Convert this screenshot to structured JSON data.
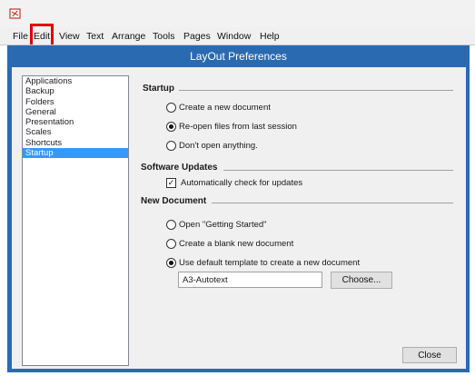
{
  "app": {
    "icon": "layout-app-icon"
  },
  "menubar": {
    "items": [
      {
        "label": "File"
      },
      {
        "label": "Edit",
        "highlighted": true
      },
      {
        "label": "View"
      },
      {
        "label": "Text"
      },
      {
        "label": "Arrange"
      },
      {
        "label": "Tools"
      },
      {
        "label": "Pages"
      },
      {
        "label": "Window"
      },
      {
        "label": "Help"
      }
    ]
  },
  "dialog": {
    "title": "LayOut Preferences",
    "categories": [
      "Applications",
      "Backup",
      "Folders",
      "General",
      "Presentation",
      "Scales",
      "Shortcuts",
      "Startup"
    ],
    "selected_category": "Startup",
    "startup": {
      "heading": "Startup",
      "options": [
        {
          "label": "Create a new document",
          "checked": false
        },
        {
          "label": "Re-open files from last session",
          "checked": true
        },
        {
          "label": "Don't open anything.",
          "checked": false
        }
      ]
    },
    "software_updates": {
      "heading": "Software Updates",
      "check_label": "Automatically check for updates",
      "checked": true
    },
    "new_document": {
      "heading": "New Document",
      "options": [
        {
          "label": "Open \"Getting Started\"",
          "checked": false
        },
        {
          "label": "Create a blank new document",
          "checked": false
        },
        {
          "label": "Use default template to create a new document",
          "checked": true
        }
      ],
      "template_value": "A3-Autotext",
      "choose_label": "Choose..."
    },
    "close_label": "Close"
  },
  "colors": {
    "accent": "#2a6ab1",
    "selection": "#3399ff",
    "highlight_box": "#e00000"
  }
}
